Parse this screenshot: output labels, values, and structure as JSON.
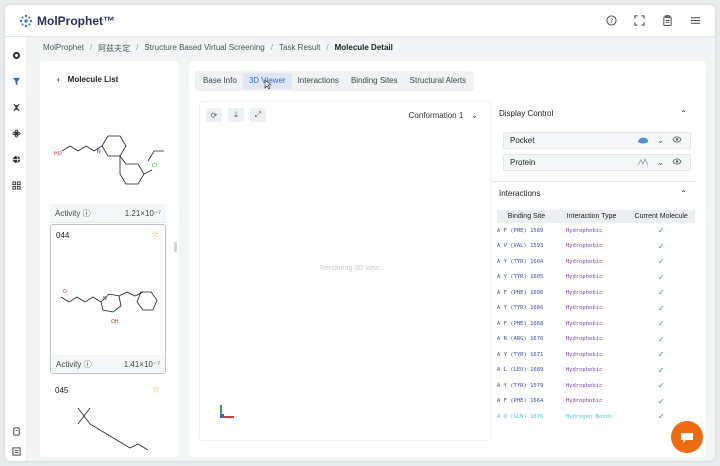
{
  "app": {
    "name": "MolProphet™"
  },
  "topbar_icons": [
    "help-icon",
    "fullscreen-icon",
    "clipboard-icon",
    "menu-icon"
  ],
  "breadcrumb": [
    "MolProphet",
    "阿兹夫定",
    "Structure Based Virtual Screening",
    "Task Result",
    "Molecule Detail"
  ],
  "molecule_list": {
    "title": "Molecule List",
    "cards": [
      {
        "id": "",
        "activity_label": "Activity",
        "activity_value": "1.21×10⁻⁷"
      },
      {
        "id": "044",
        "activity_label": "Activity",
        "activity_value": "1.41×10⁻⁷"
      },
      {
        "id": "045",
        "activity_label": "",
        "activity_value": ""
      }
    ]
  },
  "tabs": [
    "Base Info",
    "3D Viewer",
    "Interactions",
    "Binding Sites",
    "Structural Alerts"
  ],
  "active_tab": "3D Viewer",
  "viewer": {
    "conformation": "Conformation 1",
    "loading_text": "Rendering 3D view..."
  },
  "display_control": {
    "title": "Display Control",
    "items": [
      "Pocket",
      "Protein"
    ]
  },
  "interactions": {
    "title": "Interactions",
    "columns": [
      "Binding Site",
      "Interaction Type",
      "Current Molecule"
    ],
    "rows": [
      {
        "site": "A F (PHE) 1589",
        "type": "Hydrophobic"
      },
      {
        "site": "A V (VAL) 1593",
        "type": "Hydrophobic"
      },
      {
        "site": "A Y (TYR) 1604",
        "type": "Hydrophobic"
      },
      {
        "site": "A Y (TYR) 1605",
        "type": "Hydrophobic"
      },
      {
        "site": "A F (PHE) 1606",
        "type": "Hydrophobic"
      },
      {
        "site": "A Y (TYR) 1666",
        "type": "Hydrophobic"
      },
      {
        "site": "A F (PHE) 1668",
        "type": "Hydrophobic"
      },
      {
        "site": "A R (ARG) 1670",
        "type": "Hydrophobic"
      },
      {
        "site": "A Y (TYR) 1671",
        "type": "Hydrophobic"
      },
      {
        "site": "A L (LEU) 1689",
        "type": "Hydrophobic"
      },
      {
        "site": "A Y (TYR) 1579",
        "type": "Hydrophobic"
      },
      {
        "site": "A F (PHE) 1664",
        "type": "Hydrophobic"
      },
      {
        "site": "A Q (GLN) 1676",
        "type": "Hydrogen Bonds"
      }
    ]
  },
  "colors": {
    "accent": "#3867d6",
    "star": "#f5a623",
    "check": "#2ea44f",
    "chat": "#f06a12",
    "residue": "#3b4db8",
    "interaction": "#7b3fa8",
    "hbond": "#5bc0d6"
  }
}
